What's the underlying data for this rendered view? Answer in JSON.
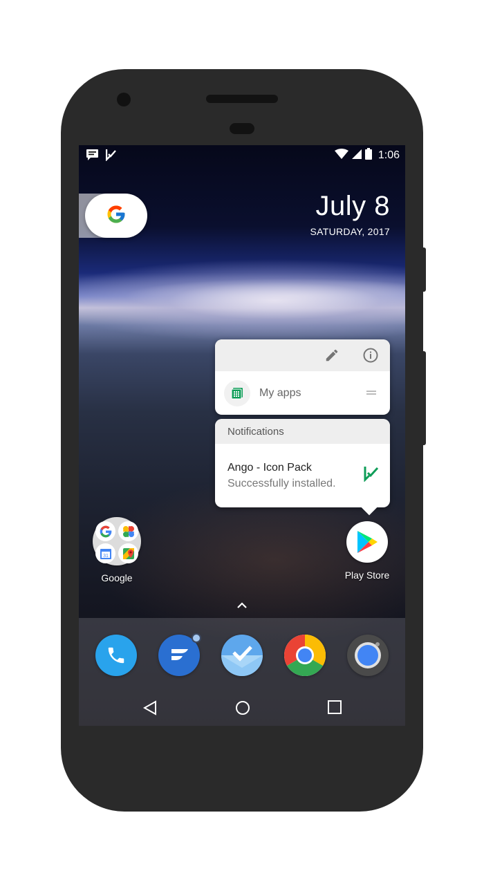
{
  "status_bar": {
    "time": "1:06",
    "left_icons": [
      "message-notification-icon",
      "ango-check-icon"
    ],
    "right_icons": [
      "wifi-icon",
      "signal-icon",
      "battery-icon"
    ]
  },
  "search_widget": {
    "icon": "google-g-icon"
  },
  "clock_widget": {
    "date": "July 8",
    "day_year": "SATURDAY, 2017"
  },
  "shortcut_popup": {
    "header_actions": [
      "edit-pencil-icon",
      "app-info-icon"
    ],
    "shortcut_label": "My apps",
    "notifications": {
      "header": "Notifications",
      "title": "Ango - Icon Pack",
      "body": "Successfully installed."
    }
  },
  "home_apps": [
    {
      "label": "Google",
      "type": "folder"
    },
    {
      "label": "Play Store",
      "type": "app"
    }
  ],
  "dock_apps": [
    "phone-icon",
    "flow-app-icon",
    "inbox-icon",
    "chrome-icon",
    "camera-icon"
  ],
  "nav_bar": [
    "back-button",
    "home-button",
    "recents-button"
  ],
  "colors": {
    "phone_body": "#2a2a2a",
    "accent_green": "#0f9d58",
    "popup_header": "#eeeeee"
  }
}
